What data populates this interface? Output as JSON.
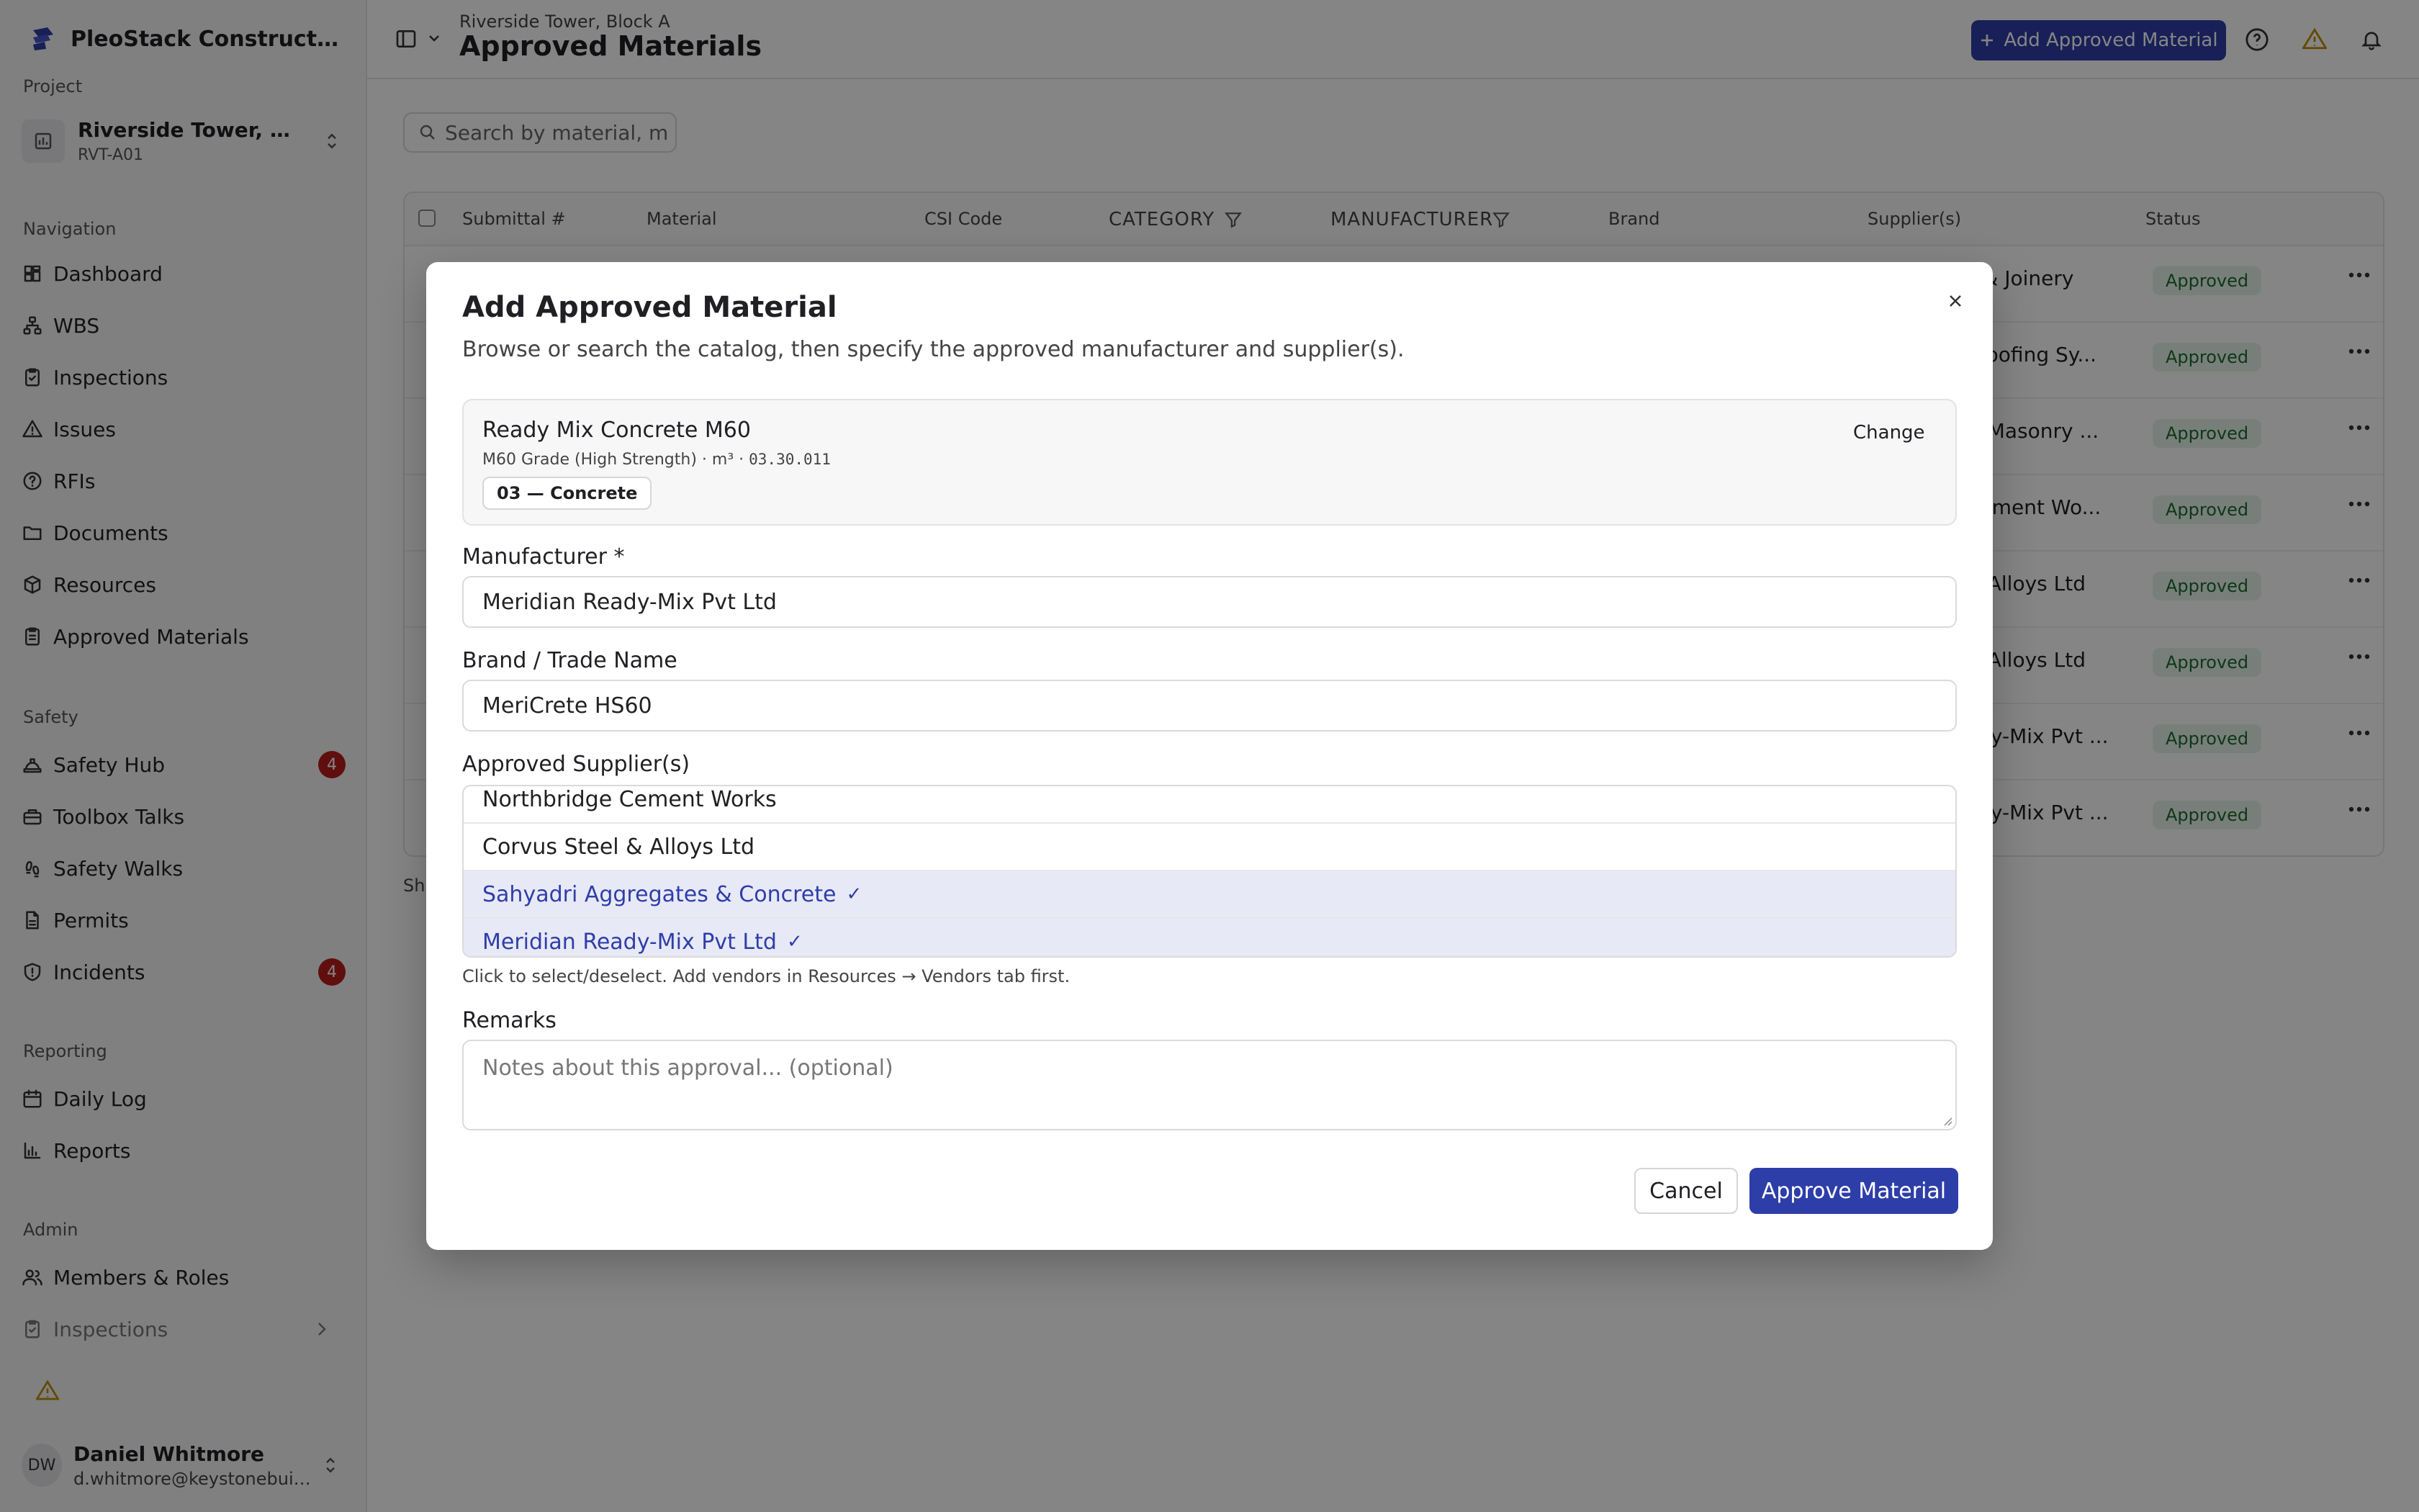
{
  "app": {
    "brand": "PleoStack Construction ...",
    "accent_color": "#2e3ea8"
  },
  "sidebar": {
    "project_label": "Project",
    "project": {
      "name": "Riverside Tower, Bloc...",
      "code": "RVT-A01"
    },
    "sections": [
      {
        "label": "Navigation",
        "items": [
          {
            "label": "Dashboard",
            "icon": "dashboard-icon"
          },
          {
            "label": "WBS",
            "icon": "hierarchy-icon"
          },
          {
            "label": "Inspections",
            "icon": "clipboard-check-icon"
          },
          {
            "label": "Issues",
            "icon": "warning-icon"
          },
          {
            "label": "RFIs",
            "icon": "question-icon"
          },
          {
            "label": "Documents",
            "icon": "folder-icon"
          },
          {
            "label": "Resources",
            "icon": "package-icon"
          },
          {
            "label": "Approved Materials",
            "icon": "clipboard-list-icon"
          }
        ]
      },
      {
        "label": "Safety",
        "items": [
          {
            "label": "Safety Hub",
            "icon": "hardhat-icon",
            "badge": "4"
          },
          {
            "label": "Toolbox Talks",
            "icon": "toolbox-icon"
          },
          {
            "label": "Safety Walks",
            "icon": "footprints-icon"
          },
          {
            "label": "Permits",
            "icon": "file-icon"
          },
          {
            "label": "Incidents",
            "icon": "shield-alert-icon",
            "badge": "4"
          }
        ]
      },
      {
        "label": "Reporting",
        "items": [
          {
            "label": "Daily Log",
            "icon": "calendar-icon"
          },
          {
            "label": "Reports",
            "icon": "bar-chart-icon"
          }
        ]
      },
      {
        "label": "Admin",
        "items": [
          {
            "label": "Members & Roles",
            "icon": "users-icon"
          },
          {
            "label": "Inspections",
            "icon": "clipboard-check-icon"
          }
        ]
      }
    ],
    "user": {
      "initials": "DW",
      "name": "Daniel Whitmore",
      "email": "d.whitmore@keystonebuil..."
    }
  },
  "header": {
    "breadcrumb": "Riverside Tower, Block A",
    "title": "Approved Materials",
    "add_button": "Add Approved Material"
  },
  "main": {
    "search_placeholder": "Search by material, m",
    "columns": [
      "Submittal #",
      "Material",
      "CSI Code",
      "CATEGORY",
      "MANUFACTURER",
      "Brand",
      "Supplier(s)",
      "Status"
    ],
    "rows": [
      {
        "supplier": "s & Joinery",
        "status": "Approved"
      },
      {
        "supplier": "proofing Sy...",
        "status": "Approved"
      },
      {
        "supplier": "& Masonry ...",
        "status": "Approved"
      },
      {
        "supplier": "Cement Wo...",
        "status": "Approved"
      },
      {
        "supplier": "& Alloys Ltd",
        "status": "Approved"
      },
      {
        "supplier": "& Alloys Ltd",
        "status": "Approved"
      },
      {
        "supplier": "ady-Mix Pvt ...",
        "status": "Approved"
      },
      {
        "supplier": "ady-Mix Pvt ...",
        "status": "Approved"
      }
    ],
    "footer_partial": "Sh"
  },
  "modal": {
    "title": "Add Approved Material",
    "subtitle": "Browse or search the catalog, then specify the approved manufacturer and supplier(s).",
    "catalog": {
      "name": "Ready Mix Concrete M60",
      "meta": "M60 Grade (High Strength) · m³ · ",
      "code": "03.30.011",
      "category": "03 — Concrete",
      "change_label": "Change"
    },
    "manufacturer_label": "Manufacturer *",
    "manufacturer_value": "Meridian Ready-Mix Pvt Ltd",
    "brand_label": "Brand / Trade Name",
    "brand_value": "MeriCrete HS60",
    "suppliers_label": "Approved Supplier(s)",
    "suppliers": [
      {
        "name": "Northbridge Cement Works",
        "selected": false
      },
      {
        "name": "Corvus Steel & Alloys Ltd",
        "selected": false
      },
      {
        "name": "Sahyadri Aggregates & Concrete",
        "selected": true
      },
      {
        "name": "Meridian Ready-Mix Pvt Ltd",
        "selected": true
      }
    ],
    "check_mark": "✓",
    "suppliers_hint": "Click to select/deselect. Add vendors in Resources → Vendors tab first.",
    "remarks_label": "Remarks",
    "remarks_placeholder": "Notes about this approval... (optional)",
    "cancel_label": "Cancel",
    "approve_label": "Approve Material"
  }
}
